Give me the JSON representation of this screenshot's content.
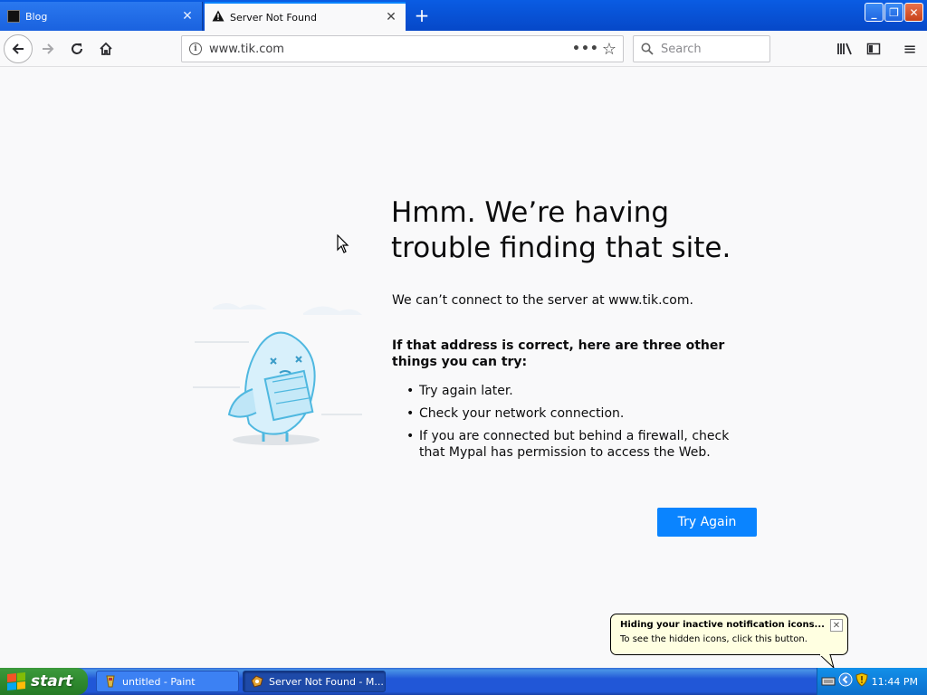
{
  "tabs": [
    {
      "title": "Blog",
      "active": false
    },
    {
      "title": "Server Not Found",
      "active": true
    }
  ],
  "navbar": {
    "url": "www.tik.com",
    "search_placeholder": "Search"
  },
  "error_page": {
    "title": "Hmm. We’re having trouble finding that site.",
    "description": "We can’t connect to the server at www.tik.com.",
    "subheading": "If that address is correct, here are three other things you can try:",
    "suggestions": [
      "Try again later.",
      "Check your network connection.",
      "If you are connected but behind a firewall, check that Mypal has permission to access the Web."
    ],
    "button_label": "Try Again"
  },
  "notification": {
    "title": "Hiding your inactive notification icons...",
    "body": "To see the hidden icons, click this button."
  },
  "taskbar": {
    "start_label": "start",
    "items": [
      {
        "label": "untitled - Paint",
        "active": false
      },
      {
        "label": "Server Not Found - M...",
        "active": true
      }
    ],
    "clock": "11:44 PM"
  },
  "colors": {
    "accent": "#0a84ff",
    "xp_blue": "#2157d7",
    "xp_start_green": "#2f8a2f",
    "balloon_bg": "#ffffe1"
  }
}
